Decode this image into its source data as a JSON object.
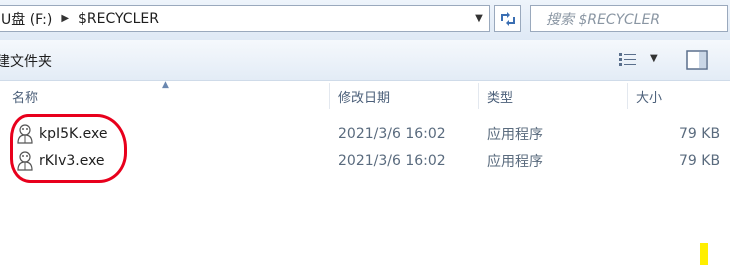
{
  "address": {
    "drive_label": "U盘 (F:)",
    "folder": "$RECYCLER",
    "separator_icon": "chevron-right-icon"
  },
  "search": {
    "placeholder": "搜索 $RECYCLER"
  },
  "toolbar": {
    "new_folder_label": "建文件夹",
    "views_icon": "details-view-icon",
    "preview_icon": "preview-pane-icon"
  },
  "columns": {
    "name": "名称",
    "modified": "修改日期",
    "type": "类型",
    "size": "大小"
  },
  "files": [
    {
      "name": "kpI5K.exe",
      "modified": "2021/3/6 16:02",
      "type": "应用程序",
      "size": "79 KB",
      "icon": "exe-app-icon"
    },
    {
      "name": "rKIv3.exe",
      "modified": "2021/3/6 16:02",
      "type": "应用程序",
      "size": "79 KB",
      "icon": "exe-app-icon"
    }
  ],
  "colors": {
    "annotation_red": "#e8001c",
    "marker_yellow": "#ffef00",
    "header_text": "#4c607a"
  }
}
